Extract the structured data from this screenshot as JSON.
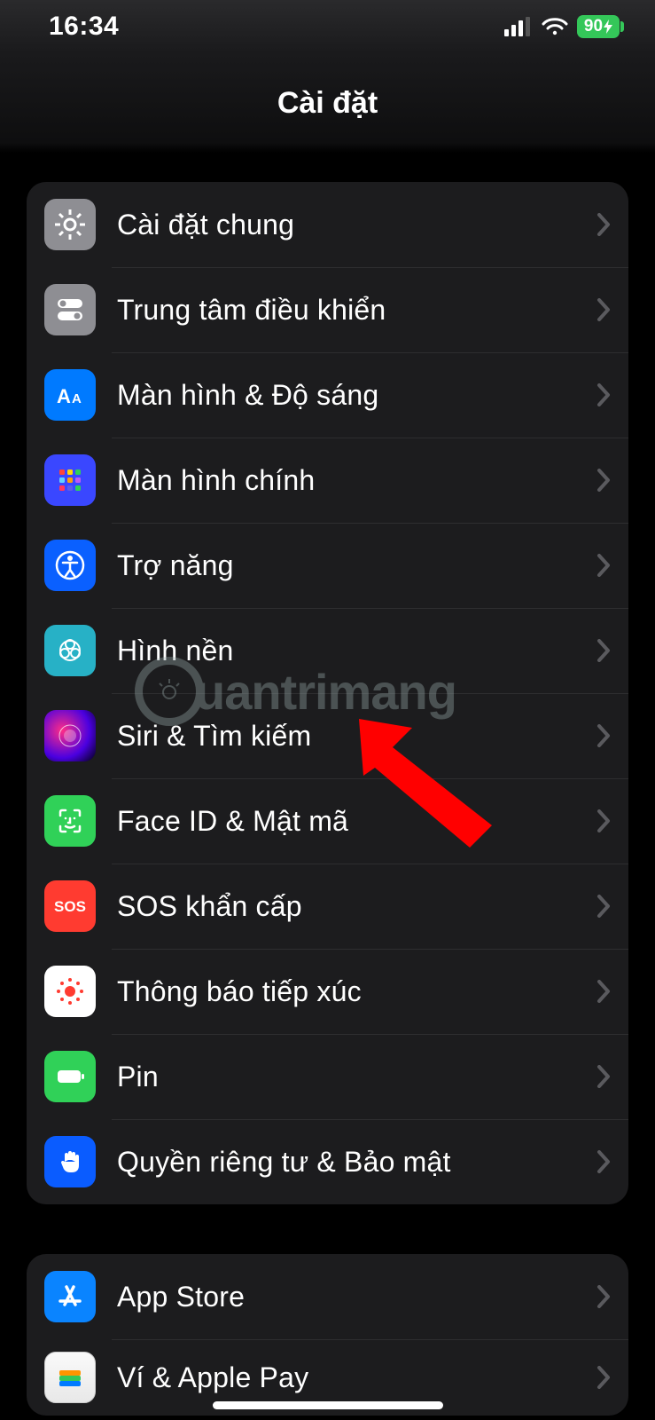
{
  "statusbar": {
    "time": "16:34",
    "battery": "90"
  },
  "header": {
    "title": "Cài đặt"
  },
  "sections": {
    "main": {
      "general": "Cài đặt chung",
      "control": "Trung tâm điều khiển",
      "display": "Màn hình & Độ sáng",
      "home": "Màn hình chính",
      "accessibility": "Trợ năng",
      "wallpaper": "Hình nền",
      "siri": "Siri & Tìm kiếm",
      "faceid": "Face ID & Mật mã",
      "sos": "SOS khẩn cấp",
      "exposure": "Thông báo tiếp xúc",
      "battery": "Pin",
      "privacy": "Quyền riêng tư & Bảo mật"
    },
    "store": {
      "appstore": "App Store",
      "wallet": "Ví & Apple Pay"
    }
  },
  "watermark": "uantrimang",
  "annotation": {
    "target": "siri",
    "type": "red-arrow"
  }
}
